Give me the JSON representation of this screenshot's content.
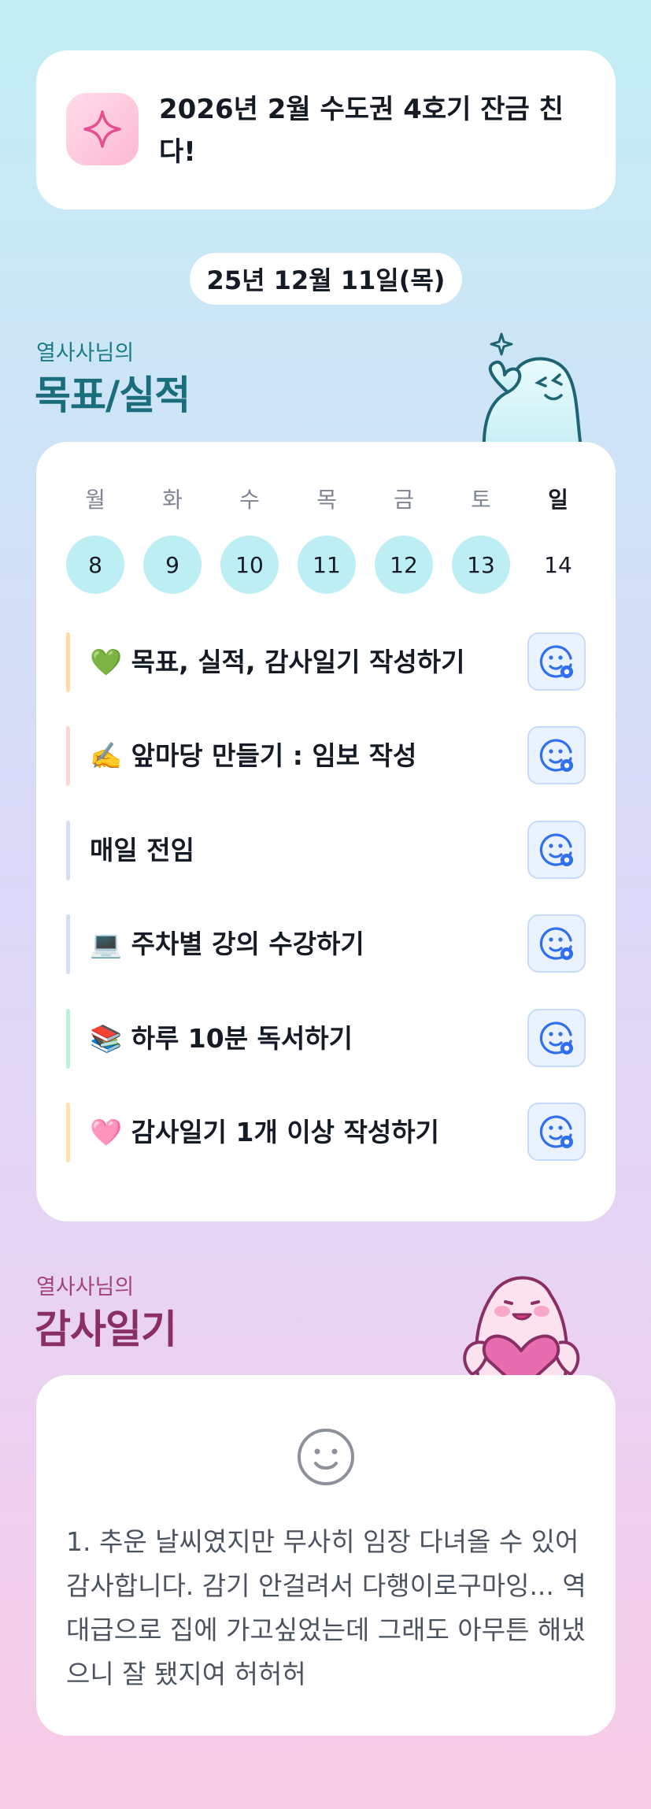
{
  "goal_banner": {
    "icon": "sparkle-icon",
    "text": "2026년 2월 수도권 4호기 잔금 친다!"
  },
  "date": "25년 12월 11일(목)",
  "goals_section": {
    "subtitle": "열사사님의",
    "title": "목표/실적"
  },
  "week": {
    "days": [
      {
        "weekday": "월",
        "date": "8"
      },
      {
        "weekday": "화",
        "date": "9"
      },
      {
        "weekday": "수",
        "date": "10"
      },
      {
        "weekday": "목",
        "date": "11"
      },
      {
        "weekday": "금",
        "date": "12"
      },
      {
        "weekday": "토",
        "date": "13"
      },
      {
        "weekday": "일",
        "date": "14"
      }
    ]
  },
  "tasks": [
    {
      "label": "💚 목표, 실적, 감사일기 작성하기",
      "bar_color": "#ffd9a8",
      "button_icon": "smile-add-icon"
    },
    {
      "label": "✍️ 앞마당 만들기 : 임보 작성",
      "bar_color": "#ffd6d6",
      "button_icon": "smile-add-icon"
    },
    {
      "label": "매일 전임",
      "bar_color": "#d5def5",
      "button_icon": "smile-add-icon"
    },
    {
      "label": "💻 주차별 강의 수강하기",
      "bar_color": "#d5def5",
      "button_icon": "smile-add-icon"
    },
    {
      "label": "📚 하루 10분 독서하기",
      "bar_color": "#bdf0d9",
      "button_icon": "smile-add-icon"
    },
    {
      "label": "🩷 감사일기 1개 이상 작성하기",
      "bar_color": "#ffe1b0",
      "button_icon": "smile-add-icon"
    }
  ],
  "diary_section": {
    "subtitle": "열사사님의",
    "title": "감사일기"
  },
  "diary": {
    "icon": "smile-face-icon",
    "text": "1. 추운 날씨였지만 무사히 임장 다녀올 수 있어 감사합니다. 감기 안걸려서 다행이로구마잉... 역대급으로 집에 가고싶었는데 그래도 아무튼 해냈으니 잘 됐지여 허허허"
  },
  "colors": {
    "accent_teal": "#1a6e7c",
    "accent_pink": "#8a2f64",
    "day_circle": "#bdeef3",
    "button_bg": "#eaf2ff",
    "button_icon": "#2f6ff0"
  }
}
